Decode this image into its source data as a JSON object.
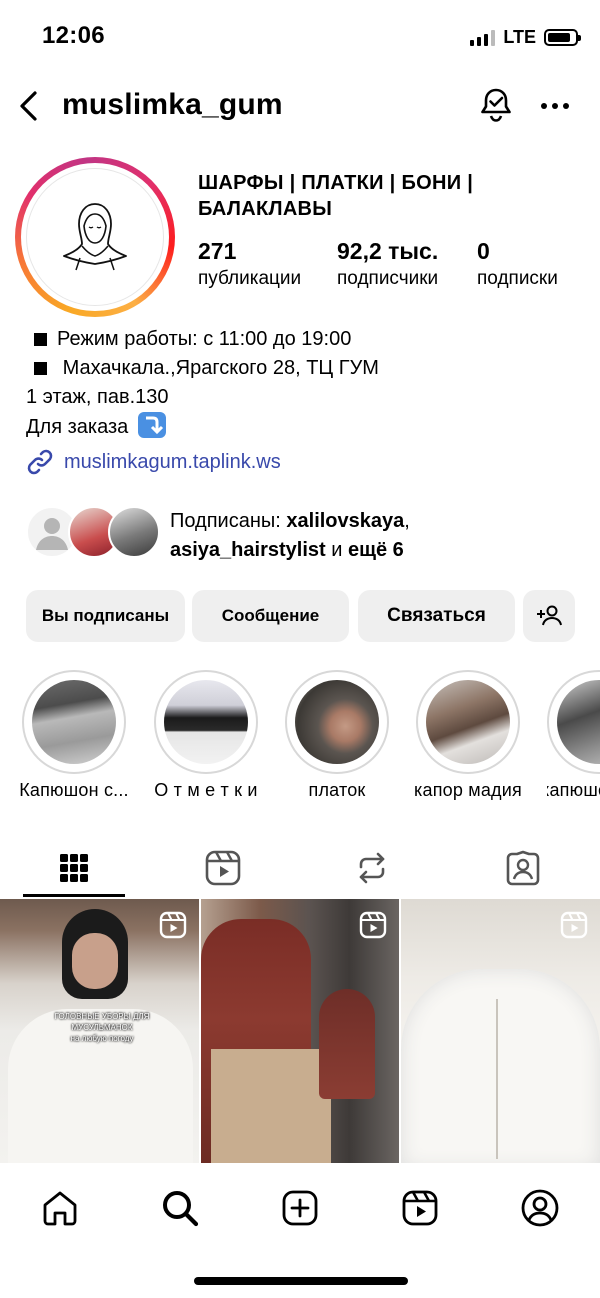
{
  "status": {
    "time": "12:06",
    "network": "LTE"
  },
  "header": {
    "username": "muslimka_gum"
  },
  "profile": {
    "title": "ШАРФЫ | ПЛАТКИ | БОНИ | БАЛАКЛАВЫ",
    "stats": [
      {
        "value": "271",
        "label": "публикации"
      },
      {
        "value": "92,2 тыс.",
        "label": "подписчики"
      },
      {
        "value": "0",
        "label": "подписки"
      }
    ],
    "bio": {
      "line1": "Режим работы: с 11:00 до 19:00",
      "line2": "Махачкала.,Ярагского 28, ТЦ ГУМ",
      "line3": "1 этаж, пав.130",
      "line4": "Для заказа"
    },
    "link": "muslimkagum.taplink.ws",
    "followed_by": {
      "prefix": "Подписаны: ",
      "user1": "xalilovskaya",
      "comma": ",",
      "user2": "asiya_hairstylist",
      "and": " и ",
      "more": "ещё 6"
    }
  },
  "buttons": {
    "following": "Вы подписаны",
    "message": "Сообщение",
    "contact": "Связаться"
  },
  "highlights": [
    {
      "label": "Капюшон с..."
    },
    {
      "label": "О т м е т к и"
    },
    {
      "label": "платок"
    },
    {
      "label": "капор мадия"
    },
    {
      "label": "капюшо"
    }
  ],
  "grid": {
    "post1_caption_line1": "ГОЛОВНЫЕ УБОРЫ ДЛЯ МУСУЛЬМАНОК",
    "post1_caption_line2": "на любую погоду"
  },
  "colors": {
    "link": "#3949ab",
    "button_bg": "#efefef"
  }
}
